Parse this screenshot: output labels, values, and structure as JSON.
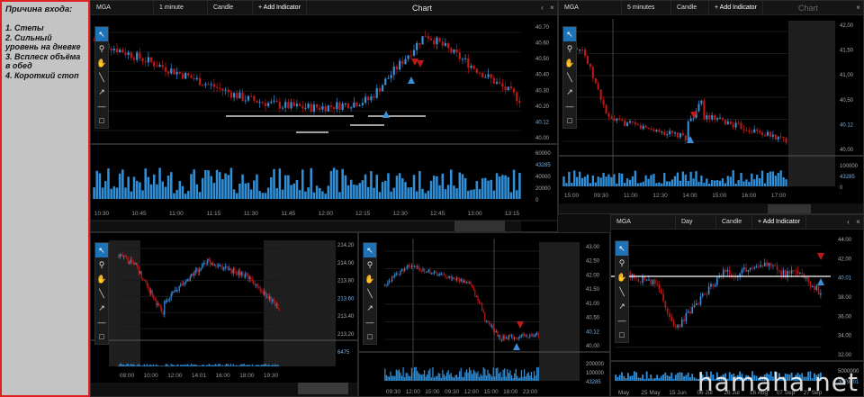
{
  "note": {
    "title": "Причина входа:",
    "items": [
      "1. Степы",
      "2. Сильный уровень на дневке",
      "3. Всплеск объёма в обед",
      "4. Короткий стоп"
    ]
  },
  "panels": {
    "p1": {
      "toolbar": {
        "symbol": "MGA",
        "timeframe": "1 minute",
        "style": "Candle",
        "add": "+ Add Indicator",
        "caption": "Chart"
      },
      "price_ticks": [
        "40.70",
        "40.60",
        "40.50",
        "40.40",
        "40.30",
        "40.20",
        "40.12",
        "40.00"
      ],
      "last_price": "40.12",
      "vol_ticks": [
        "60000",
        "43285",
        "40000",
        "20000",
        "0"
      ],
      "last_volume": "43285",
      "time_ticks": [
        "10:30",
        "10:45",
        "11:00",
        "11:15",
        "11:30",
        "11:45",
        "12:00",
        "12:15",
        "12:30",
        "12:45",
        "13:00",
        "13:15"
      ]
    },
    "p2": {
      "toolbar": {
        "symbol": "MGA",
        "timeframe": "5 minutes",
        "style": "Candle",
        "add": "+ Add Indicator",
        "caption": "Chart"
      },
      "price_ticks": [
        "42,00",
        "41,50",
        "41,00",
        "40,50",
        "40.12",
        "40,00"
      ],
      "last_price": "40.12",
      "vol_ticks": [
        "100000",
        "43285",
        "0"
      ],
      "last_volume": "43285",
      "time_ticks": [
        "15:00",
        "09:30",
        "11:00",
        "12:30",
        "14:00",
        "15:00",
        "16:00",
        "17:00"
      ]
    },
    "p3": {
      "price_ticks": [
        "214.20",
        "214.00",
        "213.80",
        "213.60",
        "213.40",
        "213.20"
      ],
      "last_price": "213.60",
      "last_volume": "6475",
      "time_ticks": [
        "08:00",
        "10:00",
        "12:00",
        "14:01",
        "16:00",
        "18:00",
        "19:30"
      ]
    },
    "p4": {
      "price_ticks": [
        "43.00",
        "42.50",
        "42.00",
        "41.50",
        "41.00",
        "40.50",
        "40.12",
        "40.00"
      ],
      "last_price": "40.12",
      "vol_ticks": [
        "200000",
        "100000",
        "43285"
      ],
      "last_volume": "43285",
      "time_ticks": [
        "09:30",
        "12:00",
        "15:00",
        "09:30",
        "12:00",
        "15:00",
        "18:00",
        "23:00"
      ]
    },
    "p5": {
      "toolbar": {
        "symbol": "MGA",
        "timeframe": "Day",
        "style": "Candle",
        "add": "+ Add Indicator"
      },
      "price_ticks": [
        "44.00",
        "42.00",
        "40.01",
        "38.00",
        "36.00",
        "34.00",
        "32.00"
      ],
      "last_price": "40.01",
      "vol_ticks": [
        "5000000",
        "3079701"
      ],
      "last_volume": "3079701",
      "time_ticks": [
        "May",
        "25 May",
        "15 Jun",
        "06 Jul",
        "26 Jul",
        "16 Aug",
        "07 Sep",
        "27 Sep"
      ]
    }
  },
  "tools": [
    {
      "icon": "cursor-icon",
      "glyph": "↖"
    },
    {
      "icon": "zoom-icon",
      "glyph": "⚲"
    },
    {
      "icon": "hand-icon",
      "glyph": "✋"
    },
    {
      "icon": "line-icon",
      "glyph": "╲"
    },
    {
      "icon": "arrow-icon",
      "glyph": "↗"
    },
    {
      "icon": "hline-icon",
      "glyph": "—"
    },
    {
      "icon": "rect-icon",
      "glyph": "□"
    }
  ],
  "colors": {
    "up": "#3a8fd8",
    "down": "#c01818",
    "bg": "#000000",
    "volume": "#2f8fd8",
    "level": "#ffffff",
    "highlight": "#1e72b8"
  },
  "watermark": "hamaha.net"
}
